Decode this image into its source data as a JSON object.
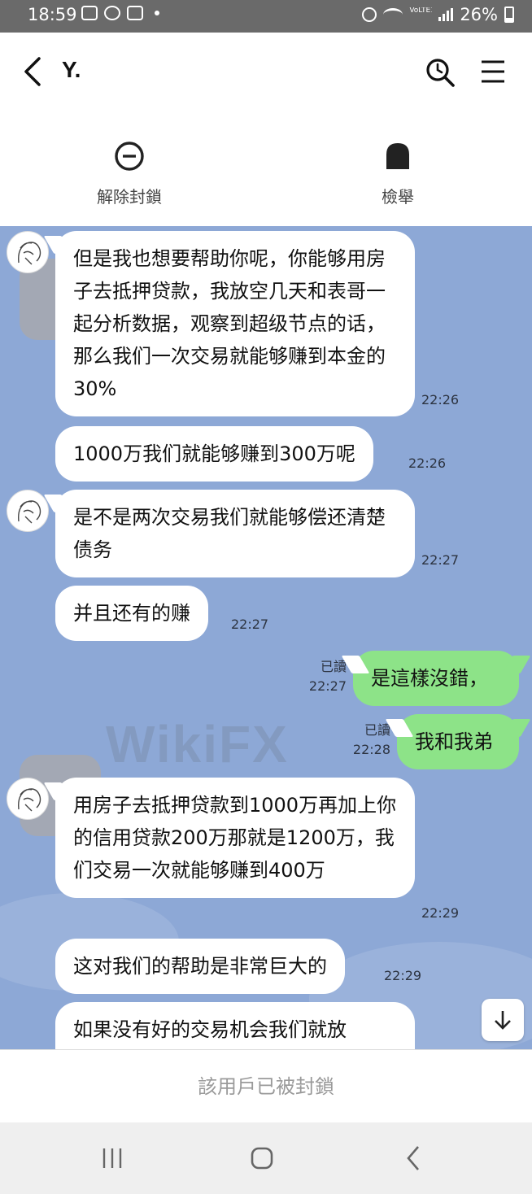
{
  "status_bar": {
    "time": "18:59",
    "battery": "26%",
    "volte": "VoLTE1"
  },
  "header": {
    "title": "Y."
  },
  "actions": {
    "unblock_label": "解除封鎖",
    "report_label": "檢舉"
  },
  "watermark": "WikiFX",
  "messages": [
    {
      "side": "them",
      "text": "但是我也想要帮助你呢，你能够用房子去抵押贷款，我放空几天和表哥一起分析数据，观察到超级节点的话，那么我们一次交易就能够赚到本金的30%",
      "time": "22:26"
    },
    {
      "side": "them",
      "text": "1000万我们就能够赚到300万呢",
      "time": "22:26"
    },
    {
      "side": "them",
      "text": "是不是两次交易我们就能够偿还清楚债务",
      "time": "22:27"
    },
    {
      "side": "them",
      "text": "并且还有的赚",
      "time": "22:27"
    },
    {
      "side": "me",
      "text": "是這樣沒錯，",
      "time": "22:27",
      "read": "已讀"
    },
    {
      "side": "me",
      "text": "我和我弟",
      "time": "22:28",
      "read": "已讀"
    },
    {
      "side": "them",
      "text": "用房子去抵押贷款到1000万再加上你的信用贷款200万那就是1200万，我们交易一次就能够赚到400万",
      "time": "22:29"
    },
    {
      "side": "them",
      "text": "这对我们的帮助是非常巨大的",
      "time": "22:29"
    },
    {
      "side": "them",
      "text": "如果没有好的交易机会我们就放",
      "time": ""
    }
  ],
  "footer": {
    "blocked_text": "該用戶已被封鎖"
  }
}
